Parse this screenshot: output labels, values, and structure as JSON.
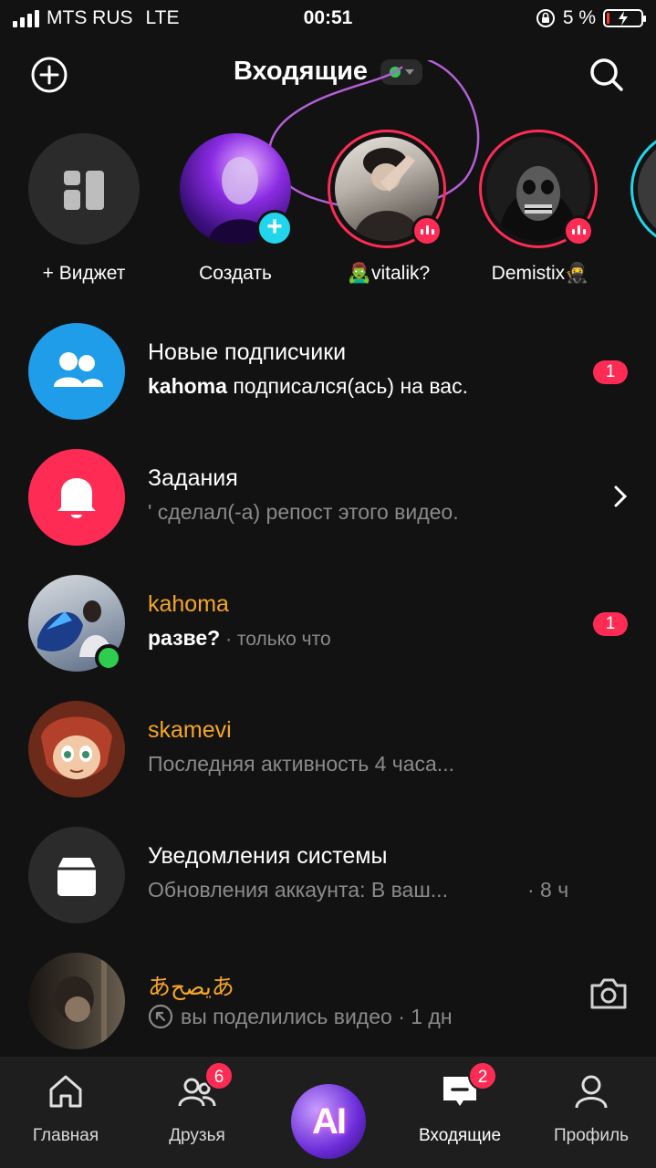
{
  "status_bar": {
    "carrier": "MTS RUS",
    "network": "LTE",
    "time": "00:51",
    "battery": "5 %"
  },
  "header": {
    "title": "Входящие",
    "status_color": "#2ecc4f"
  },
  "stories": [
    {
      "label": "+ Виджет",
      "icon": "widget-icon"
    },
    {
      "label": "Создать",
      "icon": "add-icon"
    },
    {
      "label": "🧟‍♂️vitalik?",
      "live": true
    },
    {
      "label": "Demistix🥷",
      "live": true
    }
  ],
  "inbox": [
    {
      "name": "Новые подписчики",
      "sub_bold": "kahoma",
      "sub": " подписался(ась) на вас.",
      "badge": "1",
      "icon": "people-icon"
    },
    {
      "name": "Задания",
      "sub": "' сделал(-а) репост этого видео.",
      "icon": "bell-icon",
      "chevron": true
    },
    {
      "name": "kahoma",
      "sub_msg": "разве?",
      "sub": " · только что",
      "badge": "1",
      "online": true
    },
    {
      "name": "skamevi",
      "sub": "Последняя активность 4 часа..."
    },
    {
      "name": "Уведомления системы",
      "sub": "Обновления аккаунта: В ваш...",
      "time": "· 8 ч",
      "icon": "inbox-icon"
    },
    {
      "name": "あيصحあ",
      "sub": "вы поделились видео",
      "time": " · 1 дн",
      "icon": "camera-icon"
    }
  ],
  "nav": [
    {
      "label": "Главная",
      "icon": "home-icon"
    },
    {
      "label": "Друзья",
      "icon": "friends-icon",
      "badge": "6"
    },
    {
      "label": "AI",
      "icon": "ai-icon"
    },
    {
      "label": "Входящие",
      "icon": "inbox-chat-icon",
      "badge": "2",
      "active": true
    },
    {
      "label": "Профиль",
      "icon": "profile-icon"
    }
  ],
  "colors": {
    "background": "#121212",
    "accent": "#fe2c55",
    "username": "#f5a623",
    "secondary_text": "#8a8a8a",
    "online": "#2ecc4f",
    "blue": "#1f9de8",
    "cyan": "#20d5ec"
  }
}
